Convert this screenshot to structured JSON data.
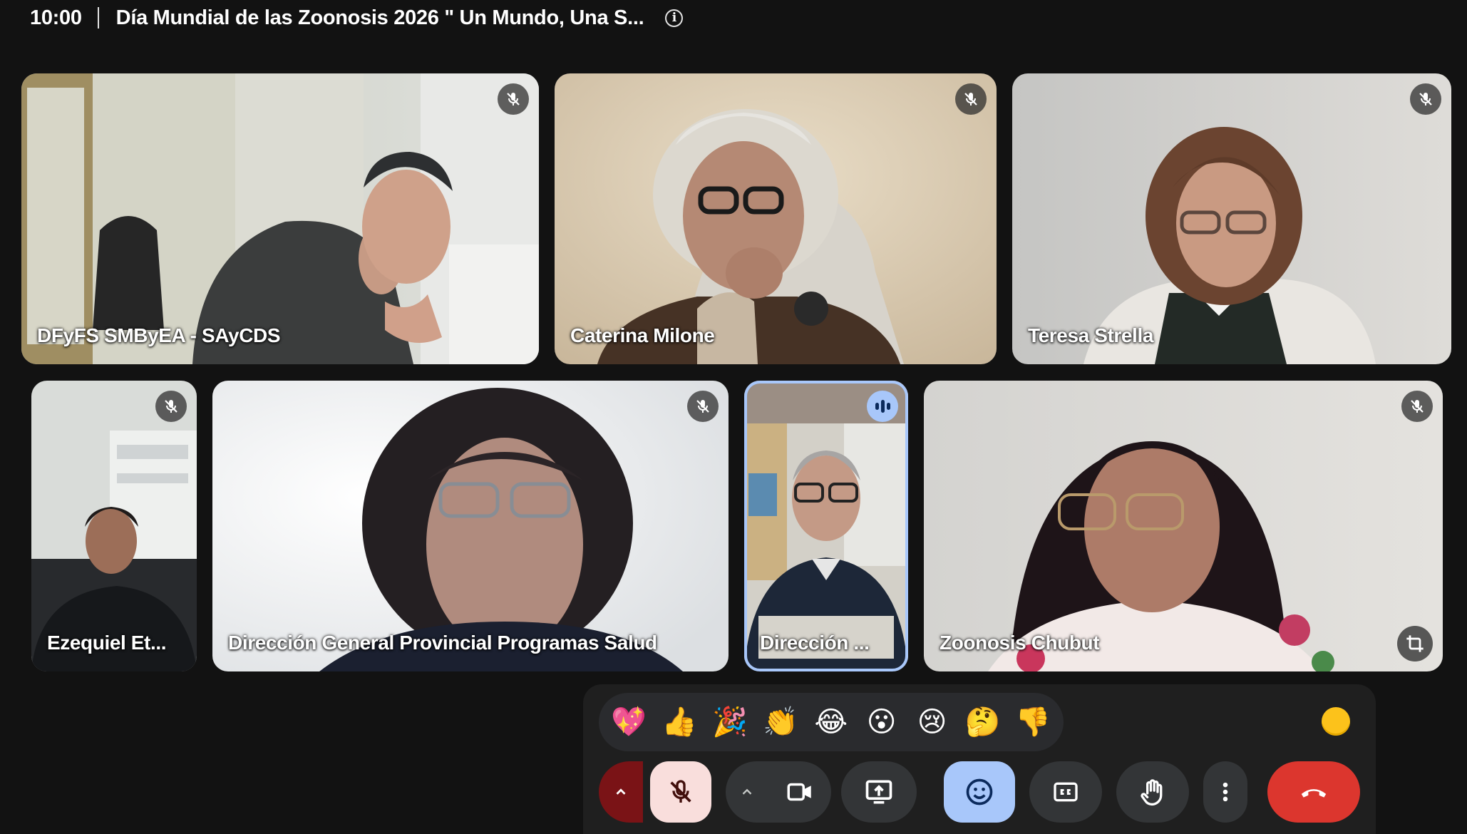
{
  "header": {
    "time": "10:00",
    "meeting_title": "Día Mundial de las Zoonosis 2026 \" Un Mundo, Una S...",
    "info_glyph": "i"
  },
  "participants": [
    {
      "name": "DFyFS SMByEA - SAyCDS",
      "mic": "muted"
    },
    {
      "name": "Caterina Milone",
      "mic": "muted"
    },
    {
      "name": "Teresa Strella",
      "mic": "muted"
    },
    {
      "name": "Ezequiel Et...",
      "mic": "muted"
    },
    {
      "name": "Dirección General Provincial Programas Salud",
      "mic": "muted"
    },
    {
      "name": "Dirección ...",
      "mic": "speaking"
    },
    {
      "name": "Zoonosis Chubut",
      "mic": "muted"
    }
  ],
  "reactions": [
    {
      "icon": "sparkling-heart-icon",
      "glyph": "💖"
    },
    {
      "icon": "thumbs-up-icon",
      "glyph": "👍"
    },
    {
      "icon": "party-popper-icon",
      "glyph": "🎉"
    },
    {
      "icon": "clapping-hands-icon",
      "glyph": "👏"
    },
    {
      "icon": "tears-of-joy-icon",
      "glyph": "😂"
    },
    {
      "icon": "surprised-face-icon",
      "glyph": "😮"
    },
    {
      "icon": "crying-face-icon",
      "glyph": "😢"
    },
    {
      "icon": "thinking-face-icon",
      "glyph": "🤔"
    },
    {
      "icon": "thumbs-down-icon",
      "glyph": "👎"
    }
  ],
  "controls": {
    "mic_state": "muted",
    "emoji_active": true,
    "colors": {
      "background": "#121212",
      "panel": "#1f1f1f",
      "button": "#333537",
      "accent_blue": "#a8c7fa",
      "mic_off_bg": "#f9dedc",
      "mic_chevron_bg": "#7a1316",
      "leave_red": "#dc362e",
      "skin_tone_yellow": "#fcc21b"
    }
  }
}
